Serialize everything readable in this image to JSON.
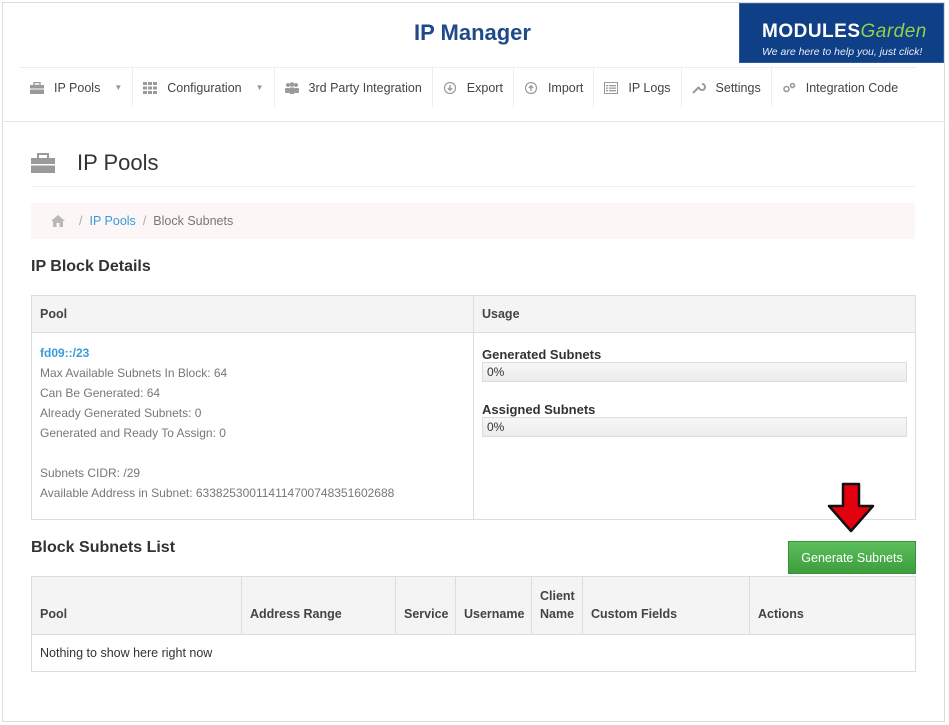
{
  "header": {
    "title": "IP Manager",
    "logo": {
      "brand_main": "MODULES",
      "brand_accent": "Garden",
      "tagline": "We are here to help you, just click!"
    }
  },
  "nav": {
    "items": [
      {
        "label": "IP Pools",
        "icon": "briefcase-icon",
        "dropdown": true
      },
      {
        "label": "Configuration",
        "icon": "grid-icon",
        "dropdown": true
      },
      {
        "label": "3rd Party Integration",
        "icon": "group-icon",
        "dropdown": false
      },
      {
        "label": "Export",
        "icon": "download-circle-icon",
        "dropdown": false
      },
      {
        "label": "Import",
        "icon": "upload-circle-icon",
        "dropdown": false
      },
      {
        "label": "IP Logs",
        "icon": "list-icon",
        "dropdown": false
      },
      {
        "label": "Settings",
        "icon": "wrench-icon",
        "dropdown": false
      },
      {
        "label": "Integration Code",
        "icon": "cogs-icon",
        "dropdown": false
      }
    ]
  },
  "page": {
    "title": "IP Pools"
  },
  "breadcrumb": {
    "home_icon": "home-icon",
    "link": "IP Pools",
    "current": "Block Subnets"
  },
  "details": {
    "heading": "IP Block Details",
    "col_pool": "Pool",
    "col_usage": "Usage",
    "pool_name": "fd09::/23",
    "lines": [
      "Max Available Subnets In Block: 64",
      "Can Be Generated: 64",
      "Already Generated Subnets: 0",
      "Generated and Ready To Assign: 0",
      "",
      "Subnets CIDR: /29",
      "Available Address in Subnet: 633825300114114700748351602688"
    ],
    "usage": [
      {
        "label": "Generated Subnets",
        "value": "0%",
        "percent": 0
      },
      {
        "label": "Assigned Subnets",
        "value": "0%",
        "percent": 0
      }
    ]
  },
  "list": {
    "heading": "Block Subnets List",
    "generate_button": "Generate Subnets",
    "columns": [
      "Pool",
      "Address Range",
      "Service",
      "Username",
      "Client Name",
      "Custom Fields",
      "Actions"
    ],
    "empty_message": "Nothing to show here right now"
  },
  "colors": {
    "accent_blue": "#3a9bd9",
    "title_blue": "#1f4a8a",
    "logo_bg": "#0f3f86",
    "button_green": "#4cae4c",
    "arrow_red": "#e3000f"
  }
}
